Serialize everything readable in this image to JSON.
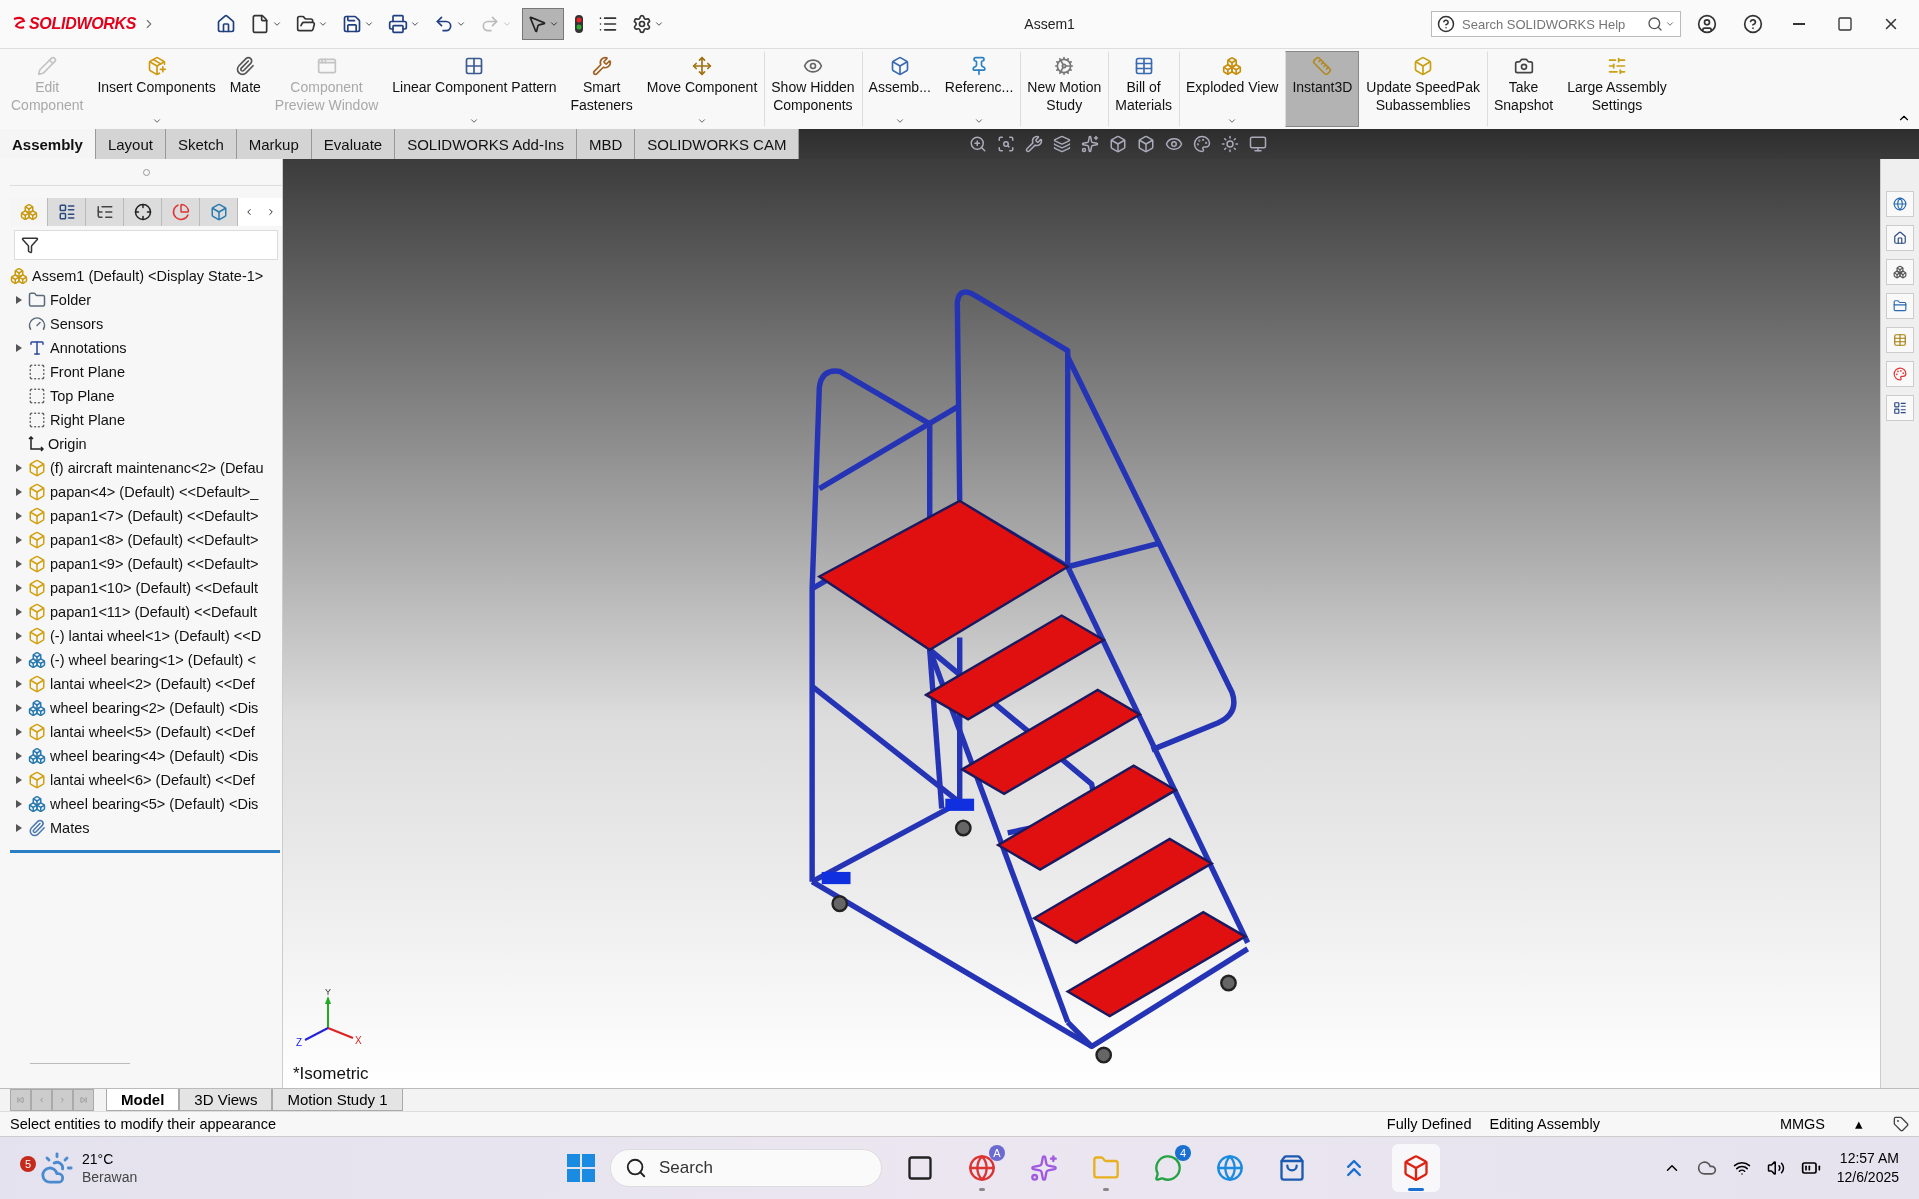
{
  "app": {
    "logo": "SOLIDWORKS",
    "title": "Assem1",
    "help_search": {
      "placeholder": "Search SOLIDWORKS Help"
    }
  },
  "commands": [
    {
      "label": "Edit\nComponent",
      "disabled": true,
      "dropdown": false,
      "selected": false,
      "group_start": false
    },
    {
      "label": "Insert Components",
      "disabled": false,
      "dropdown": true,
      "selected": false,
      "group_start": false
    },
    {
      "label": "Mate",
      "disabled": false,
      "dropdown": false,
      "selected": false,
      "group_start": false
    },
    {
      "label": "Component\nPreview Window",
      "disabled": true,
      "dropdown": false,
      "selected": false,
      "group_start": false
    },
    {
      "label": "Linear Component Pattern",
      "disabled": false,
      "dropdown": true,
      "selected": false,
      "group_start": false
    },
    {
      "label": "Smart\nFasteners",
      "disabled": false,
      "dropdown": false,
      "selected": false,
      "group_start": false
    },
    {
      "label": "Move Component",
      "disabled": false,
      "dropdown": true,
      "selected": false,
      "group_start": false
    },
    {
      "label": "Show Hidden\nComponents",
      "disabled": false,
      "dropdown": false,
      "selected": false,
      "group_start": true
    },
    {
      "label": "Assemb...",
      "disabled": false,
      "dropdown": true,
      "selected": false,
      "group_start": true
    },
    {
      "label": "Referenc...",
      "disabled": false,
      "dropdown": true,
      "selected": false,
      "group_start": false
    },
    {
      "label": "New Motion\nStudy",
      "disabled": false,
      "dropdown": false,
      "selected": false,
      "group_start": true
    },
    {
      "label": "Bill of\nMaterials",
      "disabled": false,
      "dropdown": false,
      "selected": false,
      "group_start": true
    },
    {
      "label": "Exploded View",
      "disabled": false,
      "dropdown": true,
      "selected": false,
      "group_start": true
    },
    {
      "label": "Instant3D",
      "disabled": false,
      "dropdown": false,
      "selected": true,
      "group_start": true
    },
    {
      "label": "Update SpeedPak\nSubassemblies",
      "disabled": false,
      "dropdown": false,
      "selected": false,
      "group_start": false
    },
    {
      "label": "Take\nSnapshot",
      "disabled": false,
      "dropdown": false,
      "selected": false,
      "group_start": true
    },
    {
      "label": "Large Assembly\nSettings",
      "disabled": false,
      "dropdown": false,
      "selected": false,
      "group_start": false
    }
  ],
  "tabs": [
    {
      "label": "Assembly",
      "selected": true
    },
    {
      "label": "Layout",
      "selected": false
    },
    {
      "label": "Sketch",
      "selected": false
    },
    {
      "label": "Markup",
      "selected": false
    },
    {
      "label": "Evaluate",
      "selected": false
    },
    {
      "label": "SOLIDWORKS Add-Ins",
      "selected": false
    },
    {
      "label": "MBD",
      "selected": false
    },
    {
      "label": "SOLIDWORKS CAM",
      "selected": false
    }
  ],
  "feature_tree": {
    "items": [
      {
        "label": "Assem1 (Default) <Display State-1>",
        "kind": "assembly",
        "expandable": false
      },
      {
        "label": "Folder",
        "kind": "folder",
        "expandable": true
      },
      {
        "label": "Sensors",
        "kind": "sensors",
        "expandable": false
      },
      {
        "label": "Annotations",
        "kind": "annotations",
        "expandable": true
      },
      {
        "label": "Front Plane",
        "kind": "plane",
        "expandable": false
      },
      {
        "label": "Top Plane",
        "kind": "plane",
        "expandable": false
      },
      {
        "label": "Right Plane",
        "kind": "plane",
        "expandable": false
      },
      {
        "label": "Origin",
        "kind": "origin",
        "expandable": false
      },
      {
        "label": "(f) aircraft maintenanc<2> (Defau",
        "kind": "part",
        "expandable": true
      },
      {
        "label": "papan<4> (Default) <<Default>_",
        "kind": "part",
        "expandable": true
      },
      {
        "label": "papan1<7> (Default) <<Default>",
        "kind": "part",
        "expandable": true
      },
      {
        "label": "papan1<8> (Default) <<Default>",
        "kind": "part",
        "expandable": true
      },
      {
        "label": "papan1<9> (Default) <<Default>",
        "kind": "part",
        "expandable": true
      },
      {
        "label": "papan1<10> (Default) <<Default",
        "kind": "part",
        "expandable": true
      },
      {
        "label": "papan1<11> (Default) <<Default",
        "kind": "part",
        "expandable": true
      },
      {
        "label": "(-) lantai wheel<1> (Default) <<D",
        "kind": "part",
        "expandable": true
      },
      {
        "label": "(-) wheel bearing<1> (Default) <",
        "kind": "subassembly",
        "expandable": true
      },
      {
        "label": "lantai wheel<2> (Default) <<Def",
        "kind": "part",
        "expandable": true
      },
      {
        "label": "wheel bearing<2> (Default) <Dis",
        "kind": "subassembly",
        "expandable": true
      },
      {
        "label": "lantai wheel<5> (Default) <<Def",
        "kind": "part",
        "expandable": true
      },
      {
        "label": "wheel bearing<4> (Default) <Dis",
        "kind": "subassembly",
        "expandable": true
      },
      {
        "label": "lantai wheel<6> (Default) <<Def",
        "kind": "part",
        "expandable": true
      },
      {
        "label": "wheel bearing<5> (Default) <Dis",
        "kind": "subassembly",
        "expandable": true
      },
      {
        "label": "Mates",
        "kind": "mates",
        "expandable": true
      }
    ]
  },
  "viewport": {
    "view_name": "*Isometric",
    "axes": [
      "Y",
      "X",
      "Z"
    ]
  },
  "bottom_tabs": [
    {
      "label": "Model",
      "selected": true
    },
    {
      "label": "3D Views",
      "selected": false
    },
    {
      "label": "Motion Study 1",
      "selected": false
    }
  ],
  "status_bar": {
    "message": "Select entities to modify their appearance",
    "state": "Fully Defined",
    "mode": "Editing Assembly",
    "units": "MMGS",
    "units_caret": "▴"
  },
  "taskbar": {
    "weather": {
      "badge": "5",
      "temperature": "21°C",
      "condition": "Berawan"
    },
    "search": "Search",
    "apps": [
      {
        "kind": "taskview",
        "running": false,
        "active": false
      },
      {
        "kind": "chrome",
        "running": true,
        "active": false,
        "badge": "A"
      },
      {
        "kind": "copilot",
        "running": false,
        "active": false
      },
      {
        "kind": "explorer",
        "running": true,
        "active": false
      },
      {
        "kind": "whatsapp",
        "running": false,
        "active": false,
        "badge": "4"
      },
      {
        "kind": "edge",
        "running": false,
        "active": false
      },
      {
        "kind": "store",
        "running": false,
        "active": false
      },
      {
        "kind": "ai",
        "running": false,
        "active": false
      },
      {
        "kind": "solidworks",
        "running": true,
        "active": true
      }
    ],
    "time": "12:57 AM",
    "date": "12/6/2025"
  }
}
